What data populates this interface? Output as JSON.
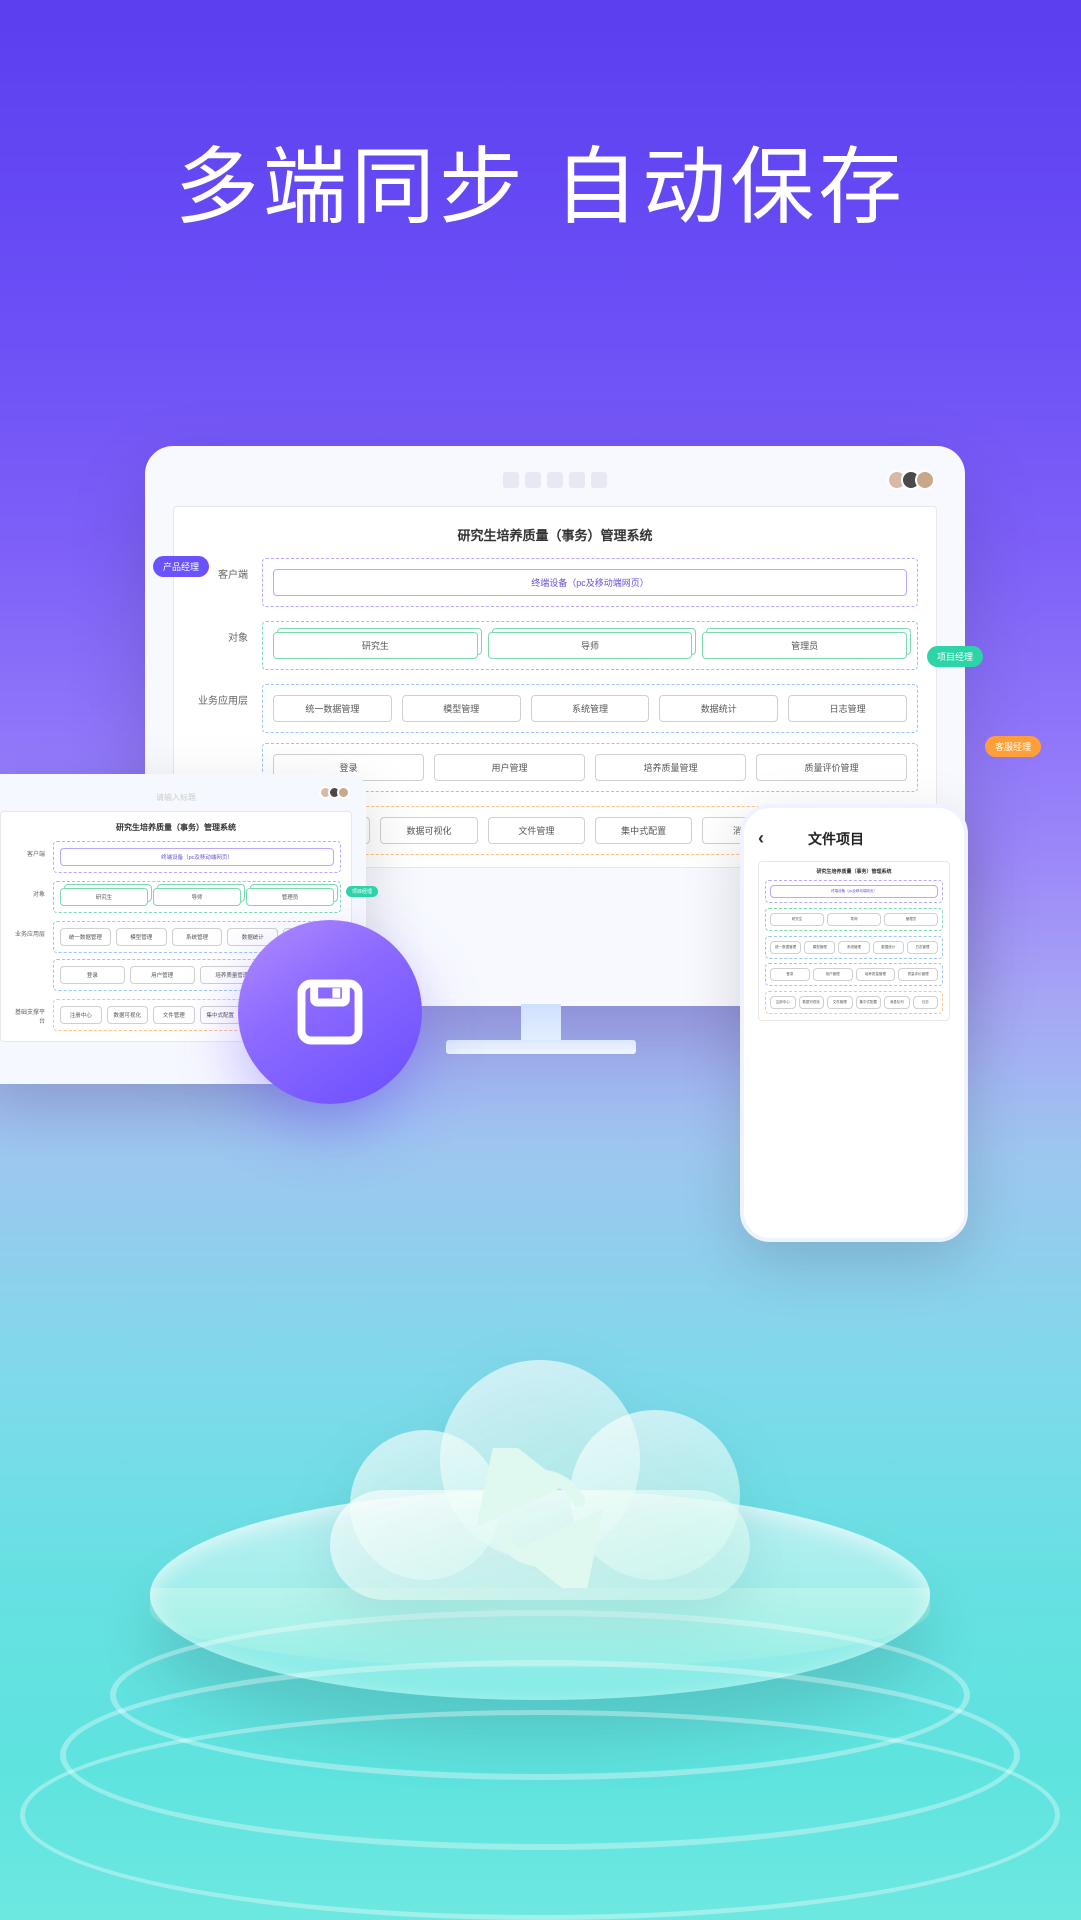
{
  "headline": "多端同步 自动保存",
  "tags": {
    "purple": "产品经理",
    "green": "项目经理",
    "orange": "客服经理"
  },
  "d": {
    "title": "研究生培养质量（事务）管理系统",
    "client_label": "客户端",
    "client_box": "终端设备（pc及移动端网页）",
    "object_label": "对象",
    "objects": [
      "研究生",
      "导师",
      "管理员"
    ],
    "app_label": "业务应用层",
    "app_r1": [
      "统一数据管理",
      "模型管理",
      "系统管理",
      "数据统计",
      "日志管理"
    ],
    "app_r2": [
      "登录",
      "用户管理",
      "培养质量管理",
      "质量评价管理"
    ],
    "support_label": "基础支撑平台",
    "support": [
      "注册中心",
      "数据可视化",
      "文件管理",
      "集中式配置",
      "消息队列",
      "日志"
    ]
  },
  "tablet_caption": "请输入标题",
  "phone_title": "文件项目"
}
